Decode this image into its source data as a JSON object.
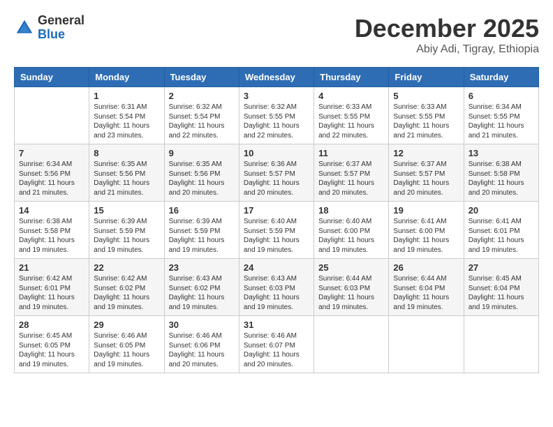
{
  "header": {
    "logo_general": "General",
    "logo_blue": "Blue",
    "month": "December 2025",
    "location": "Abiy Adi, Tigray, Ethiopia"
  },
  "weekdays": [
    "Sunday",
    "Monday",
    "Tuesday",
    "Wednesday",
    "Thursday",
    "Friday",
    "Saturday"
  ],
  "weeks": [
    [
      {
        "day": "",
        "sunrise": "",
        "sunset": "",
        "daylight": ""
      },
      {
        "day": "1",
        "sunrise": "Sunrise: 6:31 AM",
        "sunset": "Sunset: 5:54 PM",
        "daylight": "Daylight: 11 hours and 23 minutes."
      },
      {
        "day": "2",
        "sunrise": "Sunrise: 6:32 AM",
        "sunset": "Sunset: 5:54 PM",
        "daylight": "Daylight: 11 hours and 22 minutes."
      },
      {
        "day": "3",
        "sunrise": "Sunrise: 6:32 AM",
        "sunset": "Sunset: 5:55 PM",
        "daylight": "Daylight: 11 hours and 22 minutes."
      },
      {
        "day": "4",
        "sunrise": "Sunrise: 6:33 AM",
        "sunset": "Sunset: 5:55 PM",
        "daylight": "Daylight: 11 hours and 22 minutes."
      },
      {
        "day": "5",
        "sunrise": "Sunrise: 6:33 AM",
        "sunset": "Sunset: 5:55 PM",
        "daylight": "Daylight: 11 hours and 21 minutes."
      },
      {
        "day": "6",
        "sunrise": "Sunrise: 6:34 AM",
        "sunset": "Sunset: 5:55 PM",
        "daylight": "Daylight: 11 hours and 21 minutes."
      }
    ],
    [
      {
        "day": "7",
        "sunrise": "Sunrise: 6:34 AM",
        "sunset": "Sunset: 5:56 PM",
        "daylight": "Daylight: 11 hours and 21 minutes."
      },
      {
        "day": "8",
        "sunrise": "Sunrise: 6:35 AM",
        "sunset": "Sunset: 5:56 PM",
        "daylight": "Daylight: 11 hours and 21 minutes."
      },
      {
        "day": "9",
        "sunrise": "Sunrise: 6:35 AM",
        "sunset": "Sunset: 5:56 PM",
        "daylight": "Daylight: 11 hours and 20 minutes."
      },
      {
        "day": "10",
        "sunrise": "Sunrise: 6:36 AM",
        "sunset": "Sunset: 5:57 PM",
        "daylight": "Daylight: 11 hours and 20 minutes."
      },
      {
        "day": "11",
        "sunrise": "Sunrise: 6:37 AM",
        "sunset": "Sunset: 5:57 PM",
        "daylight": "Daylight: 11 hours and 20 minutes."
      },
      {
        "day": "12",
        "sunrise": "Sunrise: 6:37 AM",
        "sunset": "Sunset: 5:57 PM",
        "daylight": "Daylight: 11 hours and 20 minutes."
      },
      {
        "day": "13",
        "sunrise": "Sunrise: 6:38 AM",
        "sunset": "Sunset: 5:58 PM",
        "daylight": "Daylight: 11 hours and 20 minutes."
      }
    ],
    [
      {
        "day": "14",
        "sunrise": "Sunrise: 6:38 AM",
        "sunset": "Sunset: 5:58 PM",
        "daylight": "Daylight: 11 hours and 19 minutes."
      },
      {
        "day": "15",
        "sunrise": "Sunrise: 6:39 AM",
        "sunset": "Sunset: 5:59 PM",
        "daylight": "Daylight: 11 hours and 19 minutes."
      },
      {
        "day": "16",
        "sunrise": "Sunrise: 6:39 AM",
        "sunset": "Sunset: 5:59 PM",
        "daylight": "Daylight: 11 hours and 19 minutes."
      },
      {
        "day": "17",
        "sunrise": "Sunrise: 6:40 AM",
        "sunset": "Sunset: 5:59 PM",
        "daylight": "Daylight: 11 hours and 19 minutes."
      },
      {
        "day": "18",
        "sunrise": "Sunrise: 6:40 AM",
        "sunset": "Sunset: 6:00 PM",
        "daylight": "Daylight: 11 hours and 19 minutes."
      },
      {
        "day": "19",
        "sunrise": "Sunrise: 6:41 AM",
        "sunset": "Sunset: 6:00 PM",
        "daylight": "Daylight: 11 hours and 19 minutes."
      },
      {
        "day": "20",
        "sunrise": "Sunrise: 6:41 AM",
        "sunset": "Sunset: 6:01 PM",
        "daylight": "Daylight: 11 hours and 19 minutes."
      }
    ],
    [
      {
        "day": "21",
        "sunrise": "Sunrise: 6:42 AM",
        "sunset": "Sunset: 6:01 PM",
        "daylight": "Daylight: 11 hours and 19 minutes."
      },
      {
        "day": "22",
        "sunrise": "Sunrise: 6:42 AM",
        "sunset": "Sunset: 6:02 PM",
        "daylight": "Daylight: 11 hours and 19 minutes."
      },
      {
        "day": "23",
        "sunrise": "Sunrise: 6:43 AM",
        "sunset": "Sunset: 6:02 PM",
        "daylight": "Daylight: 11 hours and 19 minutes."
      },
      {
        "day": "24",
        "sunrise": "Sunrise: 6:43 AM",
        "sunset": "Sunset: 6:03 PM",
        "daylight": "Daylight: 11 hours and 19 minutes."
      },
      {
        "day": "25",
        "sunrise": "Sunrise: 6:44 AM",
        "sunset": "Sunset: 6:03 PM",
        "daylight": "Daylight: 11 hours and 19 minutes."
      },
      {
        "day": "26",
        "sunrise": "Sunrise: 6:44 AM",
        "sunset": "Sunset: 6:04 PM",
        "daylight": "Daylight: 11 hours and 19 minutes."
      },
      {
        "day": "27",
        "sunrise": "Sunrise: 6:45 AM",
        "sunset": "Sunset: 6:04 PM",
        "daylight": "Daylight: 11 hours and 19 minutes."
      }
    ],
    [
      {
        "day": "28",
        "sunrise": "Sunrise: 6:45 AM",
        "sunset": "Sunset: 6:05 PM",
        "daylight": "Daylight: 11 hours and 19 minutes."
      },
      {
        "day": "29",
        "sunrise": "Sunrise: 6:46 AM",
        "sunset": "Sunset: 6:05 PM",
        "daylight": "Daylight: 11 hours and 19 minutes."
      },
      {
        "day": "30",
        "sunrise": "Sunrise: 6:46 AM",
        "sunset": "Sunset: 6:06 PM",
        "daylight": "Daylight: 11 hours and 20 minutes."
      },
      {
        "day": "31",
        "sunrise": "Sunrise: 6:46 AM",
        "sunset": "Sunset: 6:07 PM",
        "daylight": "Daylight: 11 hours and 20 minutes."
      },
      {
        "day": "",
        "sunrise": "",
        "sunset": "",
        "daylight": ""
      },
      {
        "day": "",
        "sunrise": "",
        "sunset": "",
        "daylight": ""
      },
      {
        "day": "",
        "sunrise": "",
        "sunset": "",
        "daylight": ""
      }
    ]
  ]
}
